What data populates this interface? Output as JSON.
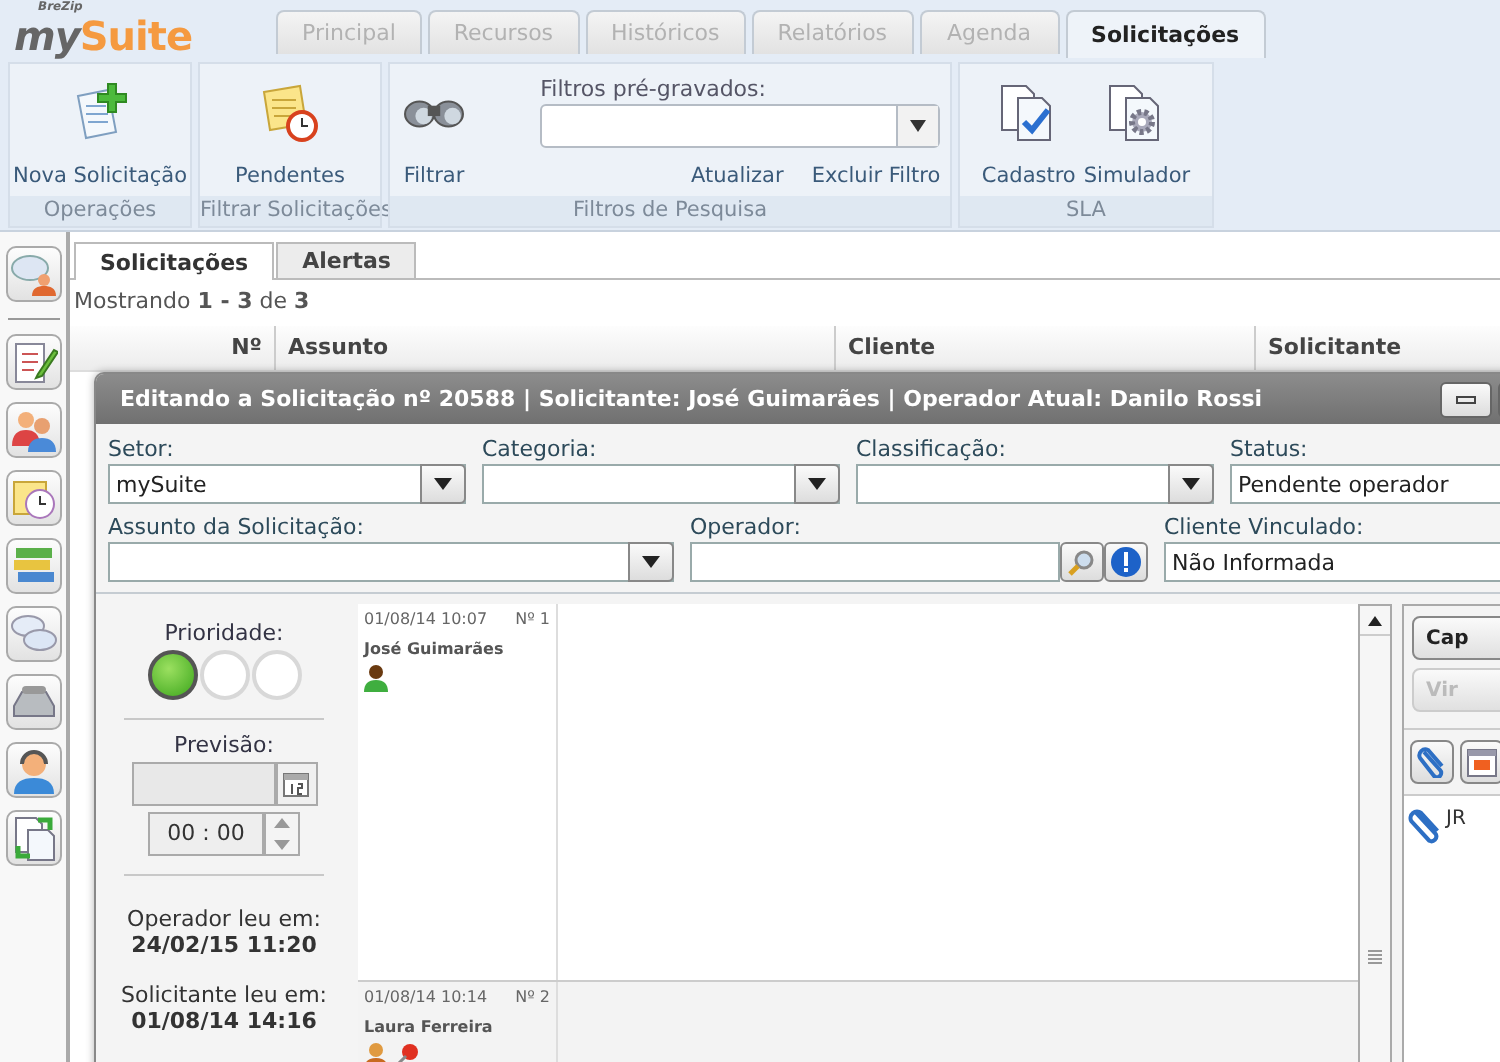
{
  "header": {
    "logo_caption": "BreZip",
    "logo_first": "my",
    "logo_second": "Suite"
  },
  "tabs": [
    {
      "label": "Principal",
      "selected": false
    },
    {
      "label": "Recursos",
      "selected": false
    },
    {
      "label": "Históricos",
      "selected": false
    },
    {
      "label": "Relatórios",
      "selected": false
    },
    {
      "label": "Agenda",
      "selected": false
    },
    {
      "label": "Solicitações",
      "selected": true
    }
  ],
  "ribbon": {
    "groups": [
      {
        "kind": "buttons",
        "label": "Operações",
        "items": [
          "Nova Solicitação"
        ]
      },
      {
        "kind": "buttons",
        "label": "Filtrar Solicitações",
        "items": [
          "Pendentes"
        ]
      },
      {
        "kind": "filters",
        "label": "Filtros de Pesquisa",
        "items": [
          "Filtrar"
        ],
        "field_label": "Filtros pré-gravados:",
        "links": [
          "Atualizar",
          "Excluir Filtro"
        ]
      },
      {
        "kind": "buttons",
        "label": "SLA",
        "items": [
          "Cadastro",
          "Simulador"
        ]
      }
    ]
  },
  "main": {
    "tabs": [
      {
        "label": "Solicitações",
        "selected": true
      },
      {
        "label": "Alertas",
        "selected": false
      }
    ],
    "summary": "Mostrando **1 - 3** de **3**",
    "table": {
      "columns": [
        "Nº",
        "Assunto",
        "Cliente",
        "Solicitante"
      ]
    }
  },
  "dialog": {
    "title": "Editando a Solicitação nº 20588 | Solicitante: José Guimarães | Operador Atual: Danilo Rossi",
    "first_row": [
      {
        "kind": "select",
        "label": "Setor:",
        "value": "mySuite"
      },
      {
        "kind": "select",
        "label": "Categoria:"
      },
      {
        "kind": "select",
        "label": "Classificação:"
      },
      {
        "kind": "text",
        "label": "Status:",
        "value": "Pendente operador"
      }
    ],
    "second_row": [
      {
        "kind": "select",
        "label": "Assunto da Solicitação:"
      },
      {
        "kind": "lookup",
        "label": "Operador:"
      },
      {
        "kind": "text",
        "label": "Cliente Vinculado:",
        "value": "Não Informada"
      }
    ],
    "priority": {
      "label": "Prioridade:",
      "levels": [
        {
          "selected": true
        },
        {
          "selected": false
        },
        {
          "selected": false
        }
      ]
    },
    "forecast": {
      "label": "Previsão:",
      "time": "00 : 00"
    },
    "reads": [
      {
        "label": "Operador leu em:",
        "value": "24/02/15 11:20"
      },
      {
        "label": "Solicitante leu em:",
        "value": "01/08/14 14:16"
      }
    ],
    "messages": [
      {
        "date": "01/08/14 10:07",
        "number": "Nº 1",
        "author": "José Guimarães"
      },
      {
        "date": "01/08/14 10:14",
        "number": "Nº 2",
        "author": "Laura Ferreira"
      }
    ],
    "side_buttons": [
      {
        "label": "Cap",
        "disabled": false
      },
      {
        "label": "Vir",
        "disabled": true
      }
    ],
    "attachments": [
      {
        "name": "JR"
      }
    ]
  }
}
